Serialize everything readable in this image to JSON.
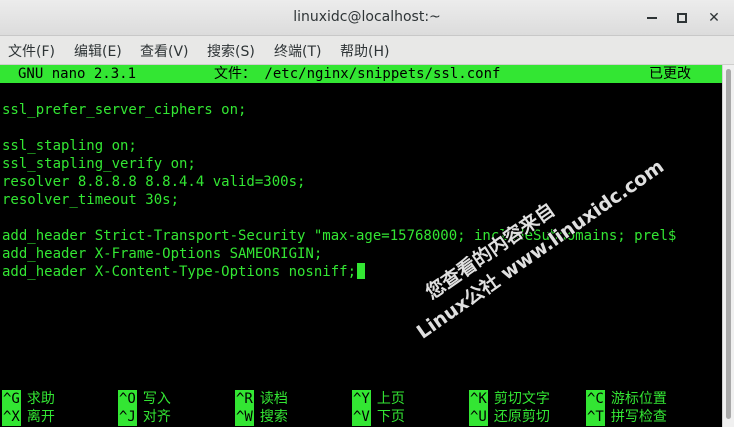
{
  "window": {
    "title": "linuxidc@localhost:~"
  },
  "menu": {
    "items": [
      "文件(F)",
      "编辑(E)",
      "查看(V)",
      "搜索(S)",
      "终端(T)",
      "帮助(H)"
    ]
  },
  "nano": {
    "version": "GNU nano 2.3.1",
    "file_label": "文件： /etc/nginx/snippets/ssl.conf",
    "status": "已更改"
  },
  "editor": {
    "lines": [
      "ssl_prefer_server_ciphers on;",
      "",
      "ssl_stapling on;",
      "ssl_stapling_verify on;",
      "resolver 8.8.8.8 8.8.4.4 valid=300s;",
      "resolver_timeout 30s;",
      "",
      "add_header Strict-Transport-Security \"max-age=15768000; includeSubdomains; prel$",
      "add_header X-Frame-Options SAMEORIGIN;",
      "add_header X-Content-Type-Options nosniff;"
    ]
  },
  "shortcuts": {
    "row1": [
      {
        "key": "^G",
        "label": "求助"
      },
      {
        "key": "^O",
        "label": "写入"
      },
      {
        "key": "^R",
        "label": "读档"
      },
      {
        "key": "^Y",
        "label": "上页"
      },
      {
        "key": "^K",
        "label": "剪切文字"
      },
      {
        "key": "^C",
        "label": "游标位置"
      }
    ],
    "row2": [
      {
        "key": "^X",
        "label": "离开"
      },
      {
        "key": "^J",
        "label": "对齐"
      },
      {
        "key": "^W",
        "label": "搜索"
      },
      {
        "key": "^V",
        "label": "下页"
      },
      {
        "key": "^U",
        "label": "还原剪切"
      },
      {
        "key": "^T",
        "label": "拼写检查"
      }
    ]
  },
  "watermark": {
    "line1": "您查看的内容来自",
    "line2": "Linux公社 www.linuxidc.com"
  },
  "colors": {
    "terminal_fg": "#33e633",
    "terminal_bg": "#000000"
  },
  "icons": {
    "minimize": "minimize-icon",
    "maximize": "maximize-icon",
    "close": "close-icon"
  }
}
